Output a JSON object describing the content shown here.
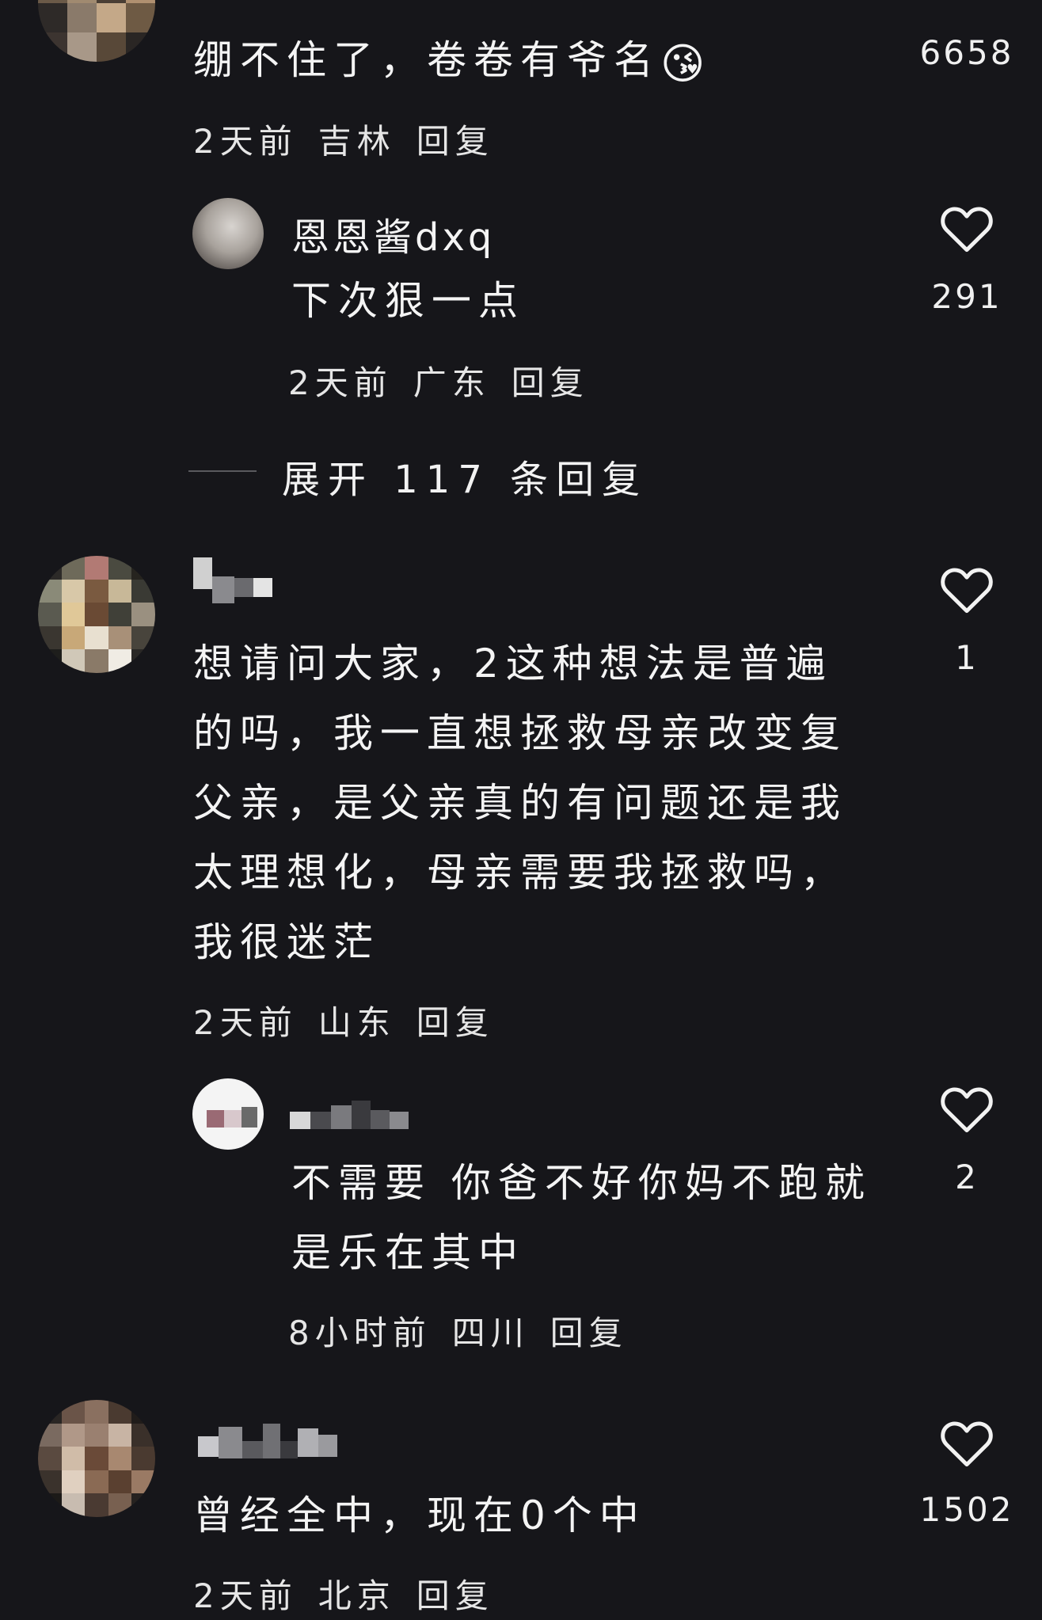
{
  "comments": [
    {
      "text": "绷不住了，卷卷有爷名",
      "emoji": "😘",
      "time": "2天前",
      "location": "吉林",
      "reply_label": "回复",
      "likes": "6658",
      "reply": {
        "username": "恩恩酱dxq",
        "text": "下次狠一点",
        "time": "2天前",
        "location": "广东",
        "reply_label": "回复",
        "likes": "291"
      },
      "expand_label": "展开 117 条回复"
    },
    {
      "text": "想请问大家，2这种想法是普遍的吗，我一直想拯救母亲改变复父亲，是父亲真的有问题还是我太理想化，母亲需要我拯救吗，我很迷茫",
      "time": "2天前",
      "location": "山东",
      "reply_label": "回复",
      "likes": "1",
      "reply": {
        "text": "不需要 你爸不好你妈不跑就是乐在其中",
        "time": "8小时前",
        "location": "四川",
        "reply_label": "回复",
        "likes": "2"
      }
    },
    {
      "text": "曾经全中，现在0个中",
      "time": "2天前",
      "location": "北京",
      "reply_label": "回复",
      "likes": "1502"
    }
  ],
  "icons": {
    "like": "heart-outline-icon"
  },
  "colors": {
    "background": "#16161a",
    "text": "#f2f2f2"
  }
}
